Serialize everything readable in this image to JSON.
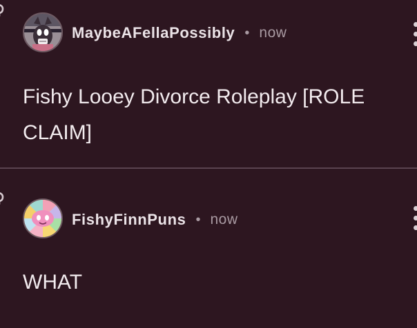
{
  "feed": {
    "posts": [
      {
        "username": "MaybeAFellaPossibly",
        "separator": "•",
        "time": "now",
        "text": "Fishy Looey Divorce Roleplay [ROLE CLAIM]",
        "avatar_icon": "masked-character-avatar"
      },
      {
        "username": "FishyFinnPuns",
        "separator": "•",
        "time": "now",
        "text": "WHAT",
        "avatar_icon": "pastel-character-avatar"
      }
    ]
  },
  "colors": {
    "background": "#2d1620",
    "divider": "#5a4450",
    "text": "#f2ebee",
    "muted": "#a99aa2"
  },
  "icons": {
    "link": "link-icon",
    "more": "more-vertical-icon"
  }
}
